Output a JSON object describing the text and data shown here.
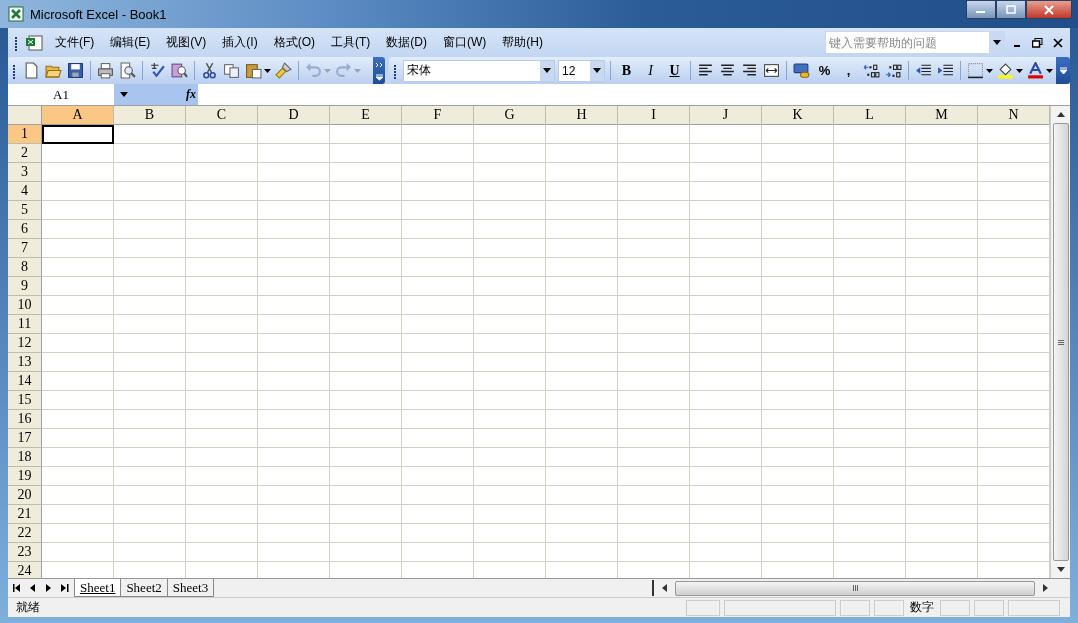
{
  "window": {
    "title": "Microsoft Excel - Book1"
  },
  "menu": [
    {
      "label": "文件(F)"
    },
    {
      "label": "编辑(E)"
    },
    {
      "label": "视图(V)"
    },
    {
      "label": "插入(I)"
    },
    {
      "label": "格式(O)"
    },
    {
      "label": "工具(T)"
    },
    {
      "label": "数据(D)"
    },
    {
      "label": "窗口(W)"
    },
    {
      "label": "帮助(H)"
    }
  ],
  "help_box": {
    "placeholder": "键入需要帮助的问题"
  },
  "formatting": {
    "font": "宋体",
    "size": "12",
    "style_buttons": [
      "B",
      "I",
      "U"
    ],
    "number_buttons": [
      "%",
      ","
    ]
  },
  "formula_bar": {
    "name_box": "A1",
    "fx": "fx"
  },
  "columns": [
    {
      "label": "A",
      "selected": true
    },
    {
      "label": "B",
      "selected": false
    },
    {
      "label": "C",
      "selected": false
    },
    {
      "label": "D",
      "selected": false
    },
    {
      "label": "E",
      "selected": false
    },
    {
      "label": "F",
      "selected": false
    },
    {
      "label": "G",
      "selected": false
    },
    {
      "label": "H",
      "selected": false
    },
    {
      "label": "I",
      "selected": false
    },
    {
      "label": "J",
      "selected": false
    },
    {
      "label": "K",
      "selected": false
    },
    {
      "label": "L",
      "selected": false
    },
    {
      "label": "M",
      "selected": false
    },
    {
      "label": "N",
      "selected": false
    }
  ],
  "rows": [
    {
      "label": "1",
      "selected": true
    },
    {
      "label": "2",
      "selected": false
    },
    {
      "label": "3",
      "selected": false
    },
    {
      "label": "4",
      "selected": false
    },
    {
      "label": "5",
      "selected": false
    },
    {
      "label": "6",
      "selected": false
    },
    {
      "label": "7",
      "selected": false
    },
    {
      "label": "8",
      "selected": false
    },
    {
      "label": "9",
      "selected": false
    },
    {
      "label": "10",
      "selected": false
    },
    {
      "label": "11",
      "selected": false
    },
    {
      "label": "12",
      "selected": false
    },
    {
      "label": "13",
      "selected": false
    },
    {
      "label": "14",
      "selected": false
    },
    {
      "label": "15",
      "selected": false
    },
    {
      "label": "16",
      "selected": false
    },
    {
      "label": "17",
      "selected": false
    },
    {
      "label": "18",
      "selected": false
    },
    {
      "label": "19",
      "selected": false
    },
    {
      "label": "20",
      "selected": false
    },
    {
      "label": "21",
      "selected": false
    },
    {
      "label": "22",
      "selected": false
    },
    {
      "label": "23",
      "selected": false
    },
    {
      "label": "24",
      "selected": false
    }
  ],
  "sheet_tabs": [
    {
      "label": "Sheet1",
      "selected": true
    },
    {
      "label": "Sheet2",
      "selected": false
    },
    {
      "label": "Sheet3",
      "selected": false
    }
  ],
  "status_bar": {
    "text": "就绪",
    "indicator": "数字"
  }
}
